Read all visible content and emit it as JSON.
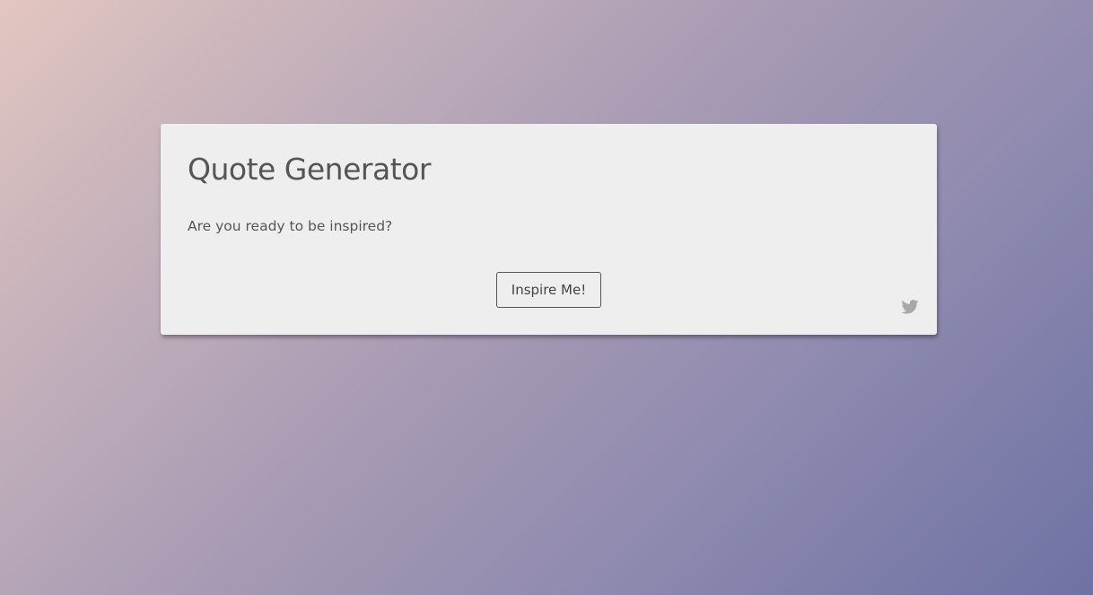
{
  "card": {
    "title": "Quote Generator",
    "quote_text": "Are you ready to be inspired?",
    "inspire_label": "Inspire Me!",
    "tweet_icon": "twitter-icon"
  },
  "colors": {
    "card_background": "#eeeeee",
    "text": "#555555",
    "icon": "#a8a8a8",
    "gradient_start": "#e3c6c0",
    "gradient_end": "#6e72a4"
  }
}
